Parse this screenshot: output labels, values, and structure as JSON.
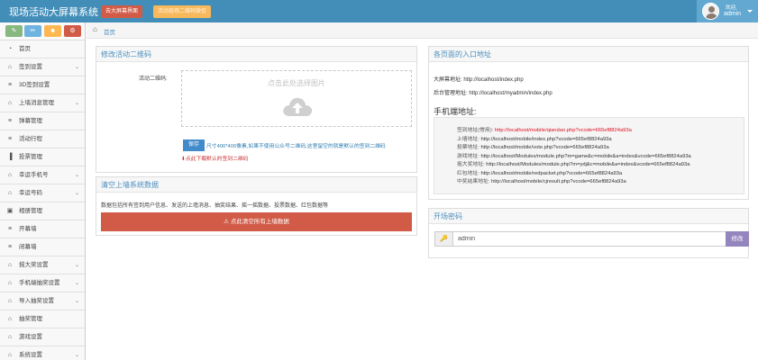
{
  "header": {
    "brand": "现场活动大屏幕系统",
    "btn_screen": "去大屏幕界面",
    "btn_scene": "活动现场二维码微信",
    "user_welcome": "欢迎,",
    "user_name": "admin",
    "bar_color": "#438eb9"
  },
  "sidebar": {
    "shortcuts": [
      {
        "icon": "comment-icon",
        "color": "#87b87f"
      },
      {
        "icon": "pencil-icon",
        "color": "#6fb3e0"
      },
      {
        "icon": "users-icon",
        "color": "#ffb752"
      },
      {
        "icon": "cogs-icon",
        "color": "#d15b47"
      }
    ],
    "items": [
      {
        "label": "首页",
        "icon": "dashboard-icon",
        "chevron": false
      },
      {
        "label": "签到设置",
        "icon": "gift-icon",
        "chevron": true
      },
      {
        "label": "3D签到设置",
        "icon": "list-icon",
        "chevron": false
      },
      {
        "label": "上墙消息管理",
        "icon": "gift-icon",
        "chevron": true
      },
      {
        "label": "弹幕管理",
        "icon": "list-icon",
        "chevron": false
      },
      {
        "label": "活动行程",
        "icon": "list-icon",
        "chevron": false
      },
      {
        "label": "投票管理",
        "icon": "bar-chart-icon",
        "chevron": false
      },
      {
        "label": "幸运手机号",
        "icon": "gift-icon",
        "chevron": true
      },
      {
        "label": "幸运号码",
        "icon": "gift-icon",
        "chevron": true
      },
      {
        "label": "相册管理",
        "icon": "picture-icon",
        "chevron": false
      },
      {
        "label": "开幕墙",
        "icon": "list-icon",
        "chevron": false
      },
      {
        "label": "闭幕墙",
        "icon": "list-icon",
        "chevron": false
      },
      {
        "label": "摇大奖设置",
        "icon": "gift-icon",
        "chevron": true
      },
      {
        "label": "手机端抽奖设置",
        "icon": "gift-icon",
        "chevron": true
      },
      {
        "label": "导入抽奖设置",
        "icon": "gift-icon",
        "chevron": true
      },
      {
        "label": "抽奖管理",
        "icon": "gift-icon",
        "chevron": false
      },
      {
        "label": "游戏设置",
        "icon": "gift-icon",
        "chevron": false
      },
      {
        "label": "系统设置",
        "icon": "gift-icon",
        "chevron": true
      }
    ]
  },
  "breadcrumb": {
    "home": "首页"
  },
  "qr_panel": {
    "title": "修改活动二维码",
    "field_label": "活动二维码:",
    "upload_text": "点击此处选择图片",
    "save_button": "保存",
    "hint": "尺寸400*400像素,如果不使用公众号二维码,这里留空的就是默认的签到二维码",
    "download_link": "点此下载默认的签到二维码"
  },
  "clear_panel": {
    "title": "清空上墙系统数据",
    "description": "数据包括所有签到用户信息、发送的上墙消息、抽奖结果、摇一摇数据、投票数据、红包数据等",
    "button": "点此清空所有上墙数据",
    "button_color": "#d15b47"
  },
  "urls_panel": {
    "title": "各页面的入口地址",
    "screen_url": "大屏幕地址:  http://localhost/index.php",
    "admin_url": "后台管理地址:  http://localhost/myadmin/index.php",
    "mobile_title": "手机端地址:",
    "links": [
      {
        "label": "签到地址(常用):",
        "url": "http://localhost/mobile/qiandao.php?vcode=665ef8824a93a",
        "highlight": true
      },
      {
        "label": "上墙地址:",
        "url": "http://localhost/mobile/index.php?vcode=665ef8824a93a",
        "highlight": false
      },
      {
        "label": "投票地址:",
        "url": "http://localhost/mobile/vote.php?vcode=665ef8824a93a",
        "highlight": false
      },
      {
        "label": "游戏地址:",
        "url": "http://localhost/Modules/module.php?m=game&c=mobile&a=index&vcode=665ef8824a93a",
        "highlight": false
      },
      {
        "label": "摇大奖地址:",
        "url": "http://localhost/Modules/module.php?m=ydj&c=mobile&a=index&vcode=665ef8824a93a",
        "highlight": false
      },
      {
        "label": "红包地址:",
        "url": "http://localhost/mobile/redpacket.php?vcode=665ef8824a93a",
        "highlight": false
      },
      {
        "label": "中奖结果地址:",
        "url": "http://localhost/mobile/cjresult.php?vcode=665ef8824a93a",
        "highlight": false
      }
    ]
  },
  "password_panel": {
    "title": "开场密码",
    "value": "admin",
    "button": "修改",
    "button_color": "#9585bf"
  }
}
